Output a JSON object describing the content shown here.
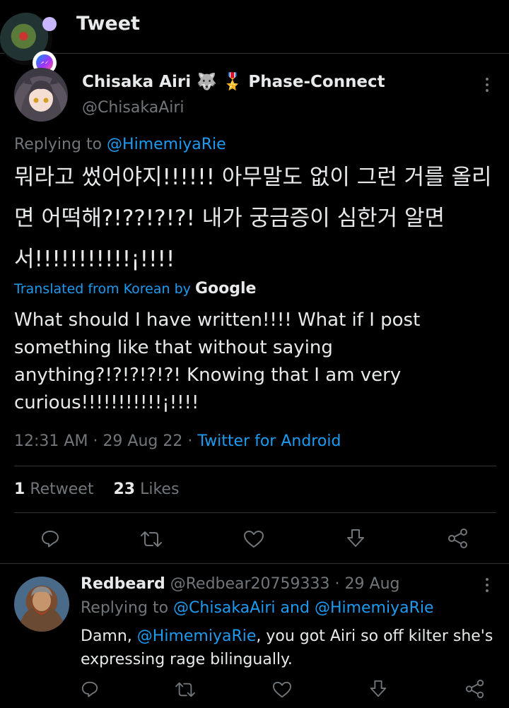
{
  "header": {
    "title": "Tweet"
  },
  "tweet": {
    "author_name": "Chisaka Airi",
    "author_emoji": "🐺 🎖️",
    "author_affiliation": "Phase-Connect",
    "author_handle": "@ChisakaAiri",
    "replying_prefix": "Replying to",
    "replying_to": "@HimemiyaRie",
    "korean_text": "뭐라고 썼어야지!!!!!! 아무말도 없이 그런 거를 올리면 어떡해?!??!?!?! 내가 궁금증이 심한거 알면서!!!!!!!!!!!¡!!!!",
    "translated_label": "Translated from Korean by",
    "translated_provider": "Google",
    "translation": "What should I have written!!!! What if I post something like that without saying anything?!?!?!?!?! Knowing that I am very curious!!!!!!!!!!!¡!!!!",
    "time": "12:31 AM",
    "date": "29 Aug 22",
    "source": "Twitter for Android",
    "retweets_count": "1",
    "retweets_label": "Retweet",
    "likes_count": "23",
    "likes_label": "Likes"
  },
  "reply": {
    "name": "Redbeard",
    "handle": "@Redbear20759333",
    "date": "29 Aug",
    "replying_prefix": "Replying to",
    "replying_to_1": "@ChisakaAiri",
    "replying_and": "and",
    "replying_to_2": "@HimemiyaRie",
    "text_before": "Damn,",
    "text_mention": "@HimemiyaRie",
    "text_after": ", you got Airi so off kilter she's expressing rage bilingually."
  },
  "icons": {
    "reply": "reply-icon",
    "retweet": "retweet-icon",
    "like": "heart-icon",
    "bookmark": "bookmark-icon",
    "share": "share-icon",
    "more": "more-icon"
  },
  "colors": {
    "background": "#000000",
    "text": "#e7e9ea",
    "muted": "#71767b",
    "link": "#1d9bf0",
    "divider": "#2f3336"
  }
}
